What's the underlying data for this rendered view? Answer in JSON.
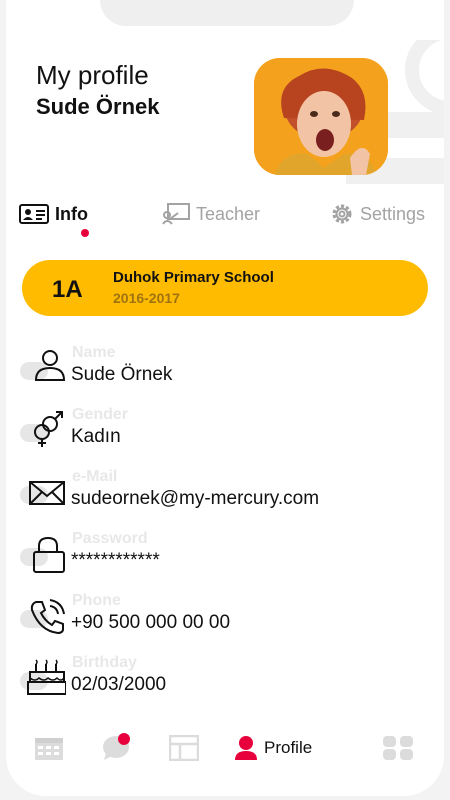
{
  "header": {
    "title": "My profile",
    "name": "Sude Örnek"
  },
  "tabs": [
    {
      "label": "Info",
      "icon": "id-card-icon",
      "active": true
    },
    {
      "label": "Teacher",
      "icon": "teacher-board-icon",
      "active": false
    },
    {
      "label": "Settings",
      "icon": "gear-icon",
      "active": false
    }
  ],
  "school": {
    "grade": "1A",
    "name": "Duhok Primary School",
    "years": "2016-2017"
  },
  "fields": [
    {
      "label": "Name",
      "value": "Sude Örnek",
      "icon": "person-icon"
    },
    {
      "label": "Gender",
      "value": "Kadın",
      "icon": "gender-icon"
    },
    {
      "label": "e-Mail",
      "value": "sudeornek@my-mercury.com",
      "icon": "mail-icon"
    },
    {
      "label": "Password",
      "value": "************",
      "icon": "lock-icon"
    },
    {
      "label": "Phone",
      "value": "+90 500 000 00 00",
      "icon": "phone-icon"
    },
    {
      "label": "Birthday",
      "value": "02/03/2000",
      "icon": "cake-icon"
    }
  ],
  "bottom_nav": [
    {
      "icon": "calendar-icon"
    },
    {
      "icon": "chat-icon",
      "has_notification": true
    },
    {
      "icon": "layout-icon"
    },
    {
      "icon": "profile-icon",
      "label": "Profile",
      "active": true
    },
    {
      "icon": "grid-icon"
    }
  ],
  "colors": {
    "accent": "#ffbb00",
    "notification": "#e8003c",
    "muted": "#a3a3a3"
  }
}
